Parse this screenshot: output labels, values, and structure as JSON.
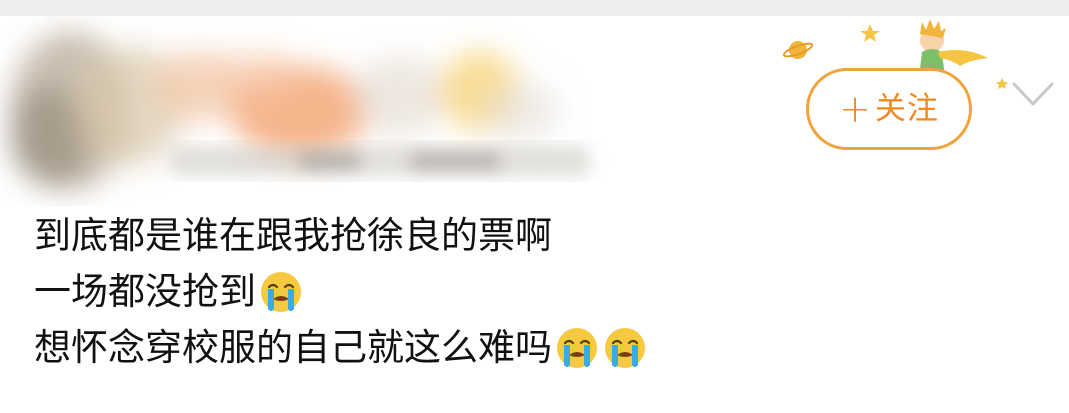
{
  "header": {
    "follow_button": {
      "plus": "+",
      "label": "关注"
    }
  },
  "post": {
    "lines": [
      {
        "text": "到底都是谁在跟我抢徐良的票啊",
        "emojis": []
      },
      {
        "text": "一场都没抢到",
        "emojis": [
          "loudly-crying-face"
        ]
      },
      {
        "text": "想怀念穿校服的自己就这么难吗",
        "emojis": [
          "loudly-crying-face",
          "loudly-crying-face"
        ]
      }
    ]
  },
  "colors": {
    "accent": "#f08a1c",
    "button_border": "#f0a33a",
    "text": "#111111",
    "chevron": "#c8c8c8"
  },
  "icons": {
    "decoration": "little-prince-icon",
    "menu": "chevron-down-icon",
    "emoji": "loudly-crying-face-icon"
  }
}
